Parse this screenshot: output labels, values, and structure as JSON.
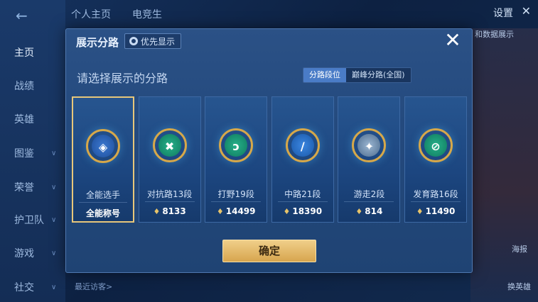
{
  "background": {
    "top_tabs": [
      "个人主页",
      "电竞生"
    ],
    "settings_label": "设置",
    "nav": [
      {
        "label": "主页",
        "active": true
      },
      {
        "label": "战绩",
        "active": false
      },
      {
        "label": "英雄",
        "active": false
      },
      {
        "label": "图鉴",
        "active": false
      },
      {
        "label": "荣誉",
        "active": false
      },
      {
        "label": "护卫队",
        "active": false
      },
      {
        "label": "游戏",
        "active": false
      },
      {
        "label": "社交",
        "active": false
      }
    ],
    "visitors_label": "最近访客>",
    "right_labels": [
      "和数据展示",
      "海报",
      "换英雄"
    ]
  },
  "dialog": {
    "title": "展示分路",
    "priority_button": "优先显示",
    "close_icon": "close-icon",
    "prompt": "请选择展示的分路",
    "toggle": {
      "active": "分路段位",
      "inactive": "巅峰分路(全国)"
    },
    "confirm_label": "确定"
  },
  "cards": [
    {
      "name": "全能选手",
      "value": "全能称号",
      "selected": true,
      "icon": "all-round-icon",
      "show_points_icon": false
    },
    {
      "name": "对抗路13段",
      "value": "8133",
      "selected": false,
      "icon": "clash-lane-icon",
      "show_points_icon": true
    },
    {
      "name": "打野19段",
      "value": "14499",
      "selected": false,
      "icon": "jungle-icon",
      "show_points_icon": true
    },
    {
      "name": "中路21段",
      "value": "18390",
      "selected": false,
      "icon": "mid-lane-icon",
      "show_points_icon": true
    },
    {
      "name": "游走2段",
      "value": "814",
      "selected": false,
      "icon": "roam-icon",
      "show_points_icon": true
    },
    {
      "name": "发育路16段",
      "value": "11490",
      "selected": false,
      "icon": "farm-lane-icon",
      "show_points_icon": true
    }
  ],
  "colors": {
    "accent_gold": "#e8c77a",
    "toggle_active": "#4a7cc7",
    "confirm_button": "#d7a54e"
  }
}
